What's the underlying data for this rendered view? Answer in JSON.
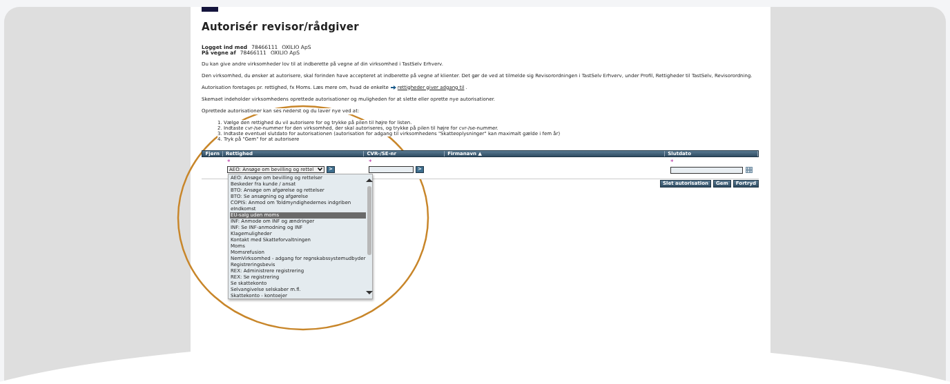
{
  "page": {
    "title": "Autorisér revisor/rådgiver",
    "login": [
      {
        "label": "Logget ind med",
        "number": "78466111",
        "company": "OXILIO ApS"
      },
      {
        "label": "På vegne af",
        "number": "78466111",
        "company": "OXILIO ApS"
      }
    ],
    "paragraphs": [
      "Du kan give andre virksomheder lov til at indberette på vegne af din virksomhed i TastSelv Erhverv.",
      "Den virksomhed, du ønsker at autorisere, skal forinden have accepteret at indberette på vegne af klienter. Det gør de ved at tilmelde sig Revisorordningen i TastSelv Erhverv, under Profil, Rettigheder til TastSelv, Revisorordning."
    ],
    "link_paragraph": {
      "text": "Autorisation foretages pr. rettighed, fx Moms. Læs mere om, hvad de enkelte",
      "link": "rettigheder giver adgang til",
      "after": "."
    },
    "paragraphs_2": [
      "Skemaet indeholder virksomhedens oprettede autorisationer og muligheden for at slette eller oprette nye autorisationer.",
      "Oprettede autorisationer kan ses nederst og du laver nye ved at:"
    ],
    "steps": [
      "1. Vælge den rettighed du vil autorisere for og trykke på pilen til højre for listen.",
      "2. Indtaste cvr-/se-nummer for den virksomhed, der skal autoriseres, og trykke på pilen til højre for cvr-/se-nummer.",
      "3. Indtaste eventuel slutdato for autorisationen (autorisation for adgang til virksomhedens \"Skatteoplysninger\" kan maximalt gælde i fem år)",
      "4. Tryk på \"Gem\" for at autorisere"
    ]
  },
  "table": {
    "columns": [
      "Fjern",
      "Rettighed",
      "CVR-/SE-nr",
      "Firmanavn ▲",
      "Slutdato"
    ],
    "required_mark": "*",
    "rettighed_select": {
      "value": "AEO: Ansøge om bevilling og rettel"
    },
    "arrow_button": ">"
  },
  "dropdown": {
    "options": [
      {
        "label": "AEO: Ansøge om bevilling og rettelser",
        "selected": false
      },
      {
        "label": "Beskeder fra kunde / ansat",
        "selected": false
      },
      {
        "label": "BTO: Ansøge om afgørelse og rettelser",
        "selected": false
      },
      {
        "label": "BTO: Se ansøgning og afgørelse",
        "selected": false
      },
      {
        "label": "COPIS: Anmod om Toldmyndighedernes indgriben",
        "selected": false
      },
      {
        "label": "eIndkomst",
        "selected": false
      },
      {
        "label": "EU-salg uden moms",
        "selected": true
      },
      {
        "label": "INF: Anmode om INF og ændringer",
        "selected": false
      },
      {
        "label": "INF: Se INF-anmodning og INF",
        "selected": false
      },
      {
        "label": "Klagemuligheder",
        "selected": false
      },
      {
        "label": "Kontakt med Skatteforvaltningen",
        "selected": false
      },
      {
        "label": "Moms",
        "selected": false
      },
      {
        "label": "Momsrefusion",
        "selected": false
      },
      {
        "label": "NemVirksomhed - adgang for regnskabssystemudbyder",
        "selected": false
      },
      {
        "label": "Registreringsbevis",
        "selected": false
      },
      {
        "label": "REX: Administrere registrering",
        "selected": false
      },
      {
        "label": "REX: Se registrering",
        "selected": false
      },
      {
        "label": "Se skattekonto",
        "selected": false
      },
      {
        "label": "Selvangivelse selskaber m.fl.",
        "selected": false
      },
      {
        "label": "Skattekonto - kontoejer",
        "selected": false
      }
    ]
  },
  "buttons": [
    "Slet autorisation",
    "Gem",
    "Fortryd"
  ]
}
